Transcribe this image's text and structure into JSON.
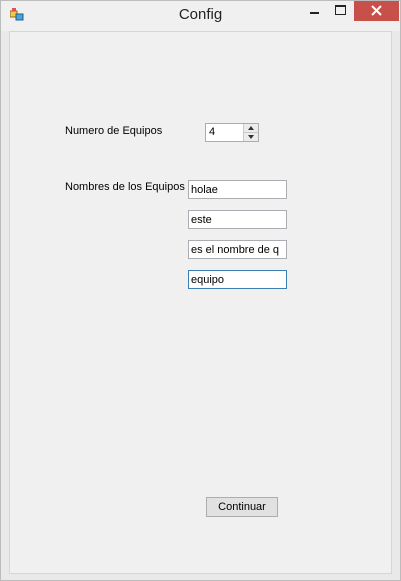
{
  "window": {
    "title": "Config",
    "icon": "app-window-icon",
    "controls": [
      "minimize-icon",
      "maximize-icon",
      "close-icon"
    ]
  },
  "form": {
    "team_count_label": "Numero de Equipos",
    "team_count_value": "4",
    "team_names_label": "Nombres de los Equipos",
    "team_names": [
      "holae",
      "este",
      "es el nombre de q",
      "equipo"
    ],
    "continue_label": "Continuar"
  },
  "colors": {
    "close_button": "#c7504b",
    "background": "#f0f0f0",
    "focused_border": "#3c7fb1"
  }
}
